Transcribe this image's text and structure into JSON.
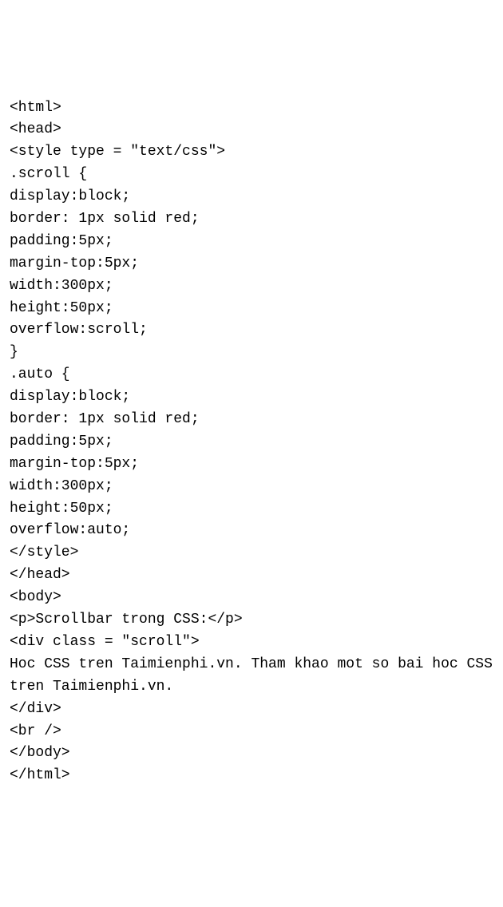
{
  "code": {
    "lines": [
      "<html>",
      "<head>",
      "<style type = \"text/css\">",
      ".scroll {",
      "display:block;",
      "border: 1px solid red;",
      "padding:5px;",
      "margin-top:5px;",
      "width:300px;",
      "height:50px;",
      "overflow:scroll;",
      "}",
      ".auto {",
      "display:block;",
      "border: 1px solid red;",
      "padding:5px;",
      "margin-top:5px;",
      "width:300px;",
      "height:50px;",
      "overflow:auto;",
      "</style>",
      "</head>",
      "<body>",
      "<p>Scrollbar trong CSS:</p>",
      "<div class = \"scroll\">",
      "Hoc CSS tren Taimienphi.vn. Tham khao mot so bai hoc CSS tren Taimienphi.vn.",
      "</div>",
      "<br />",
      "</body>",
      "</html>"
    ]
  }
}
